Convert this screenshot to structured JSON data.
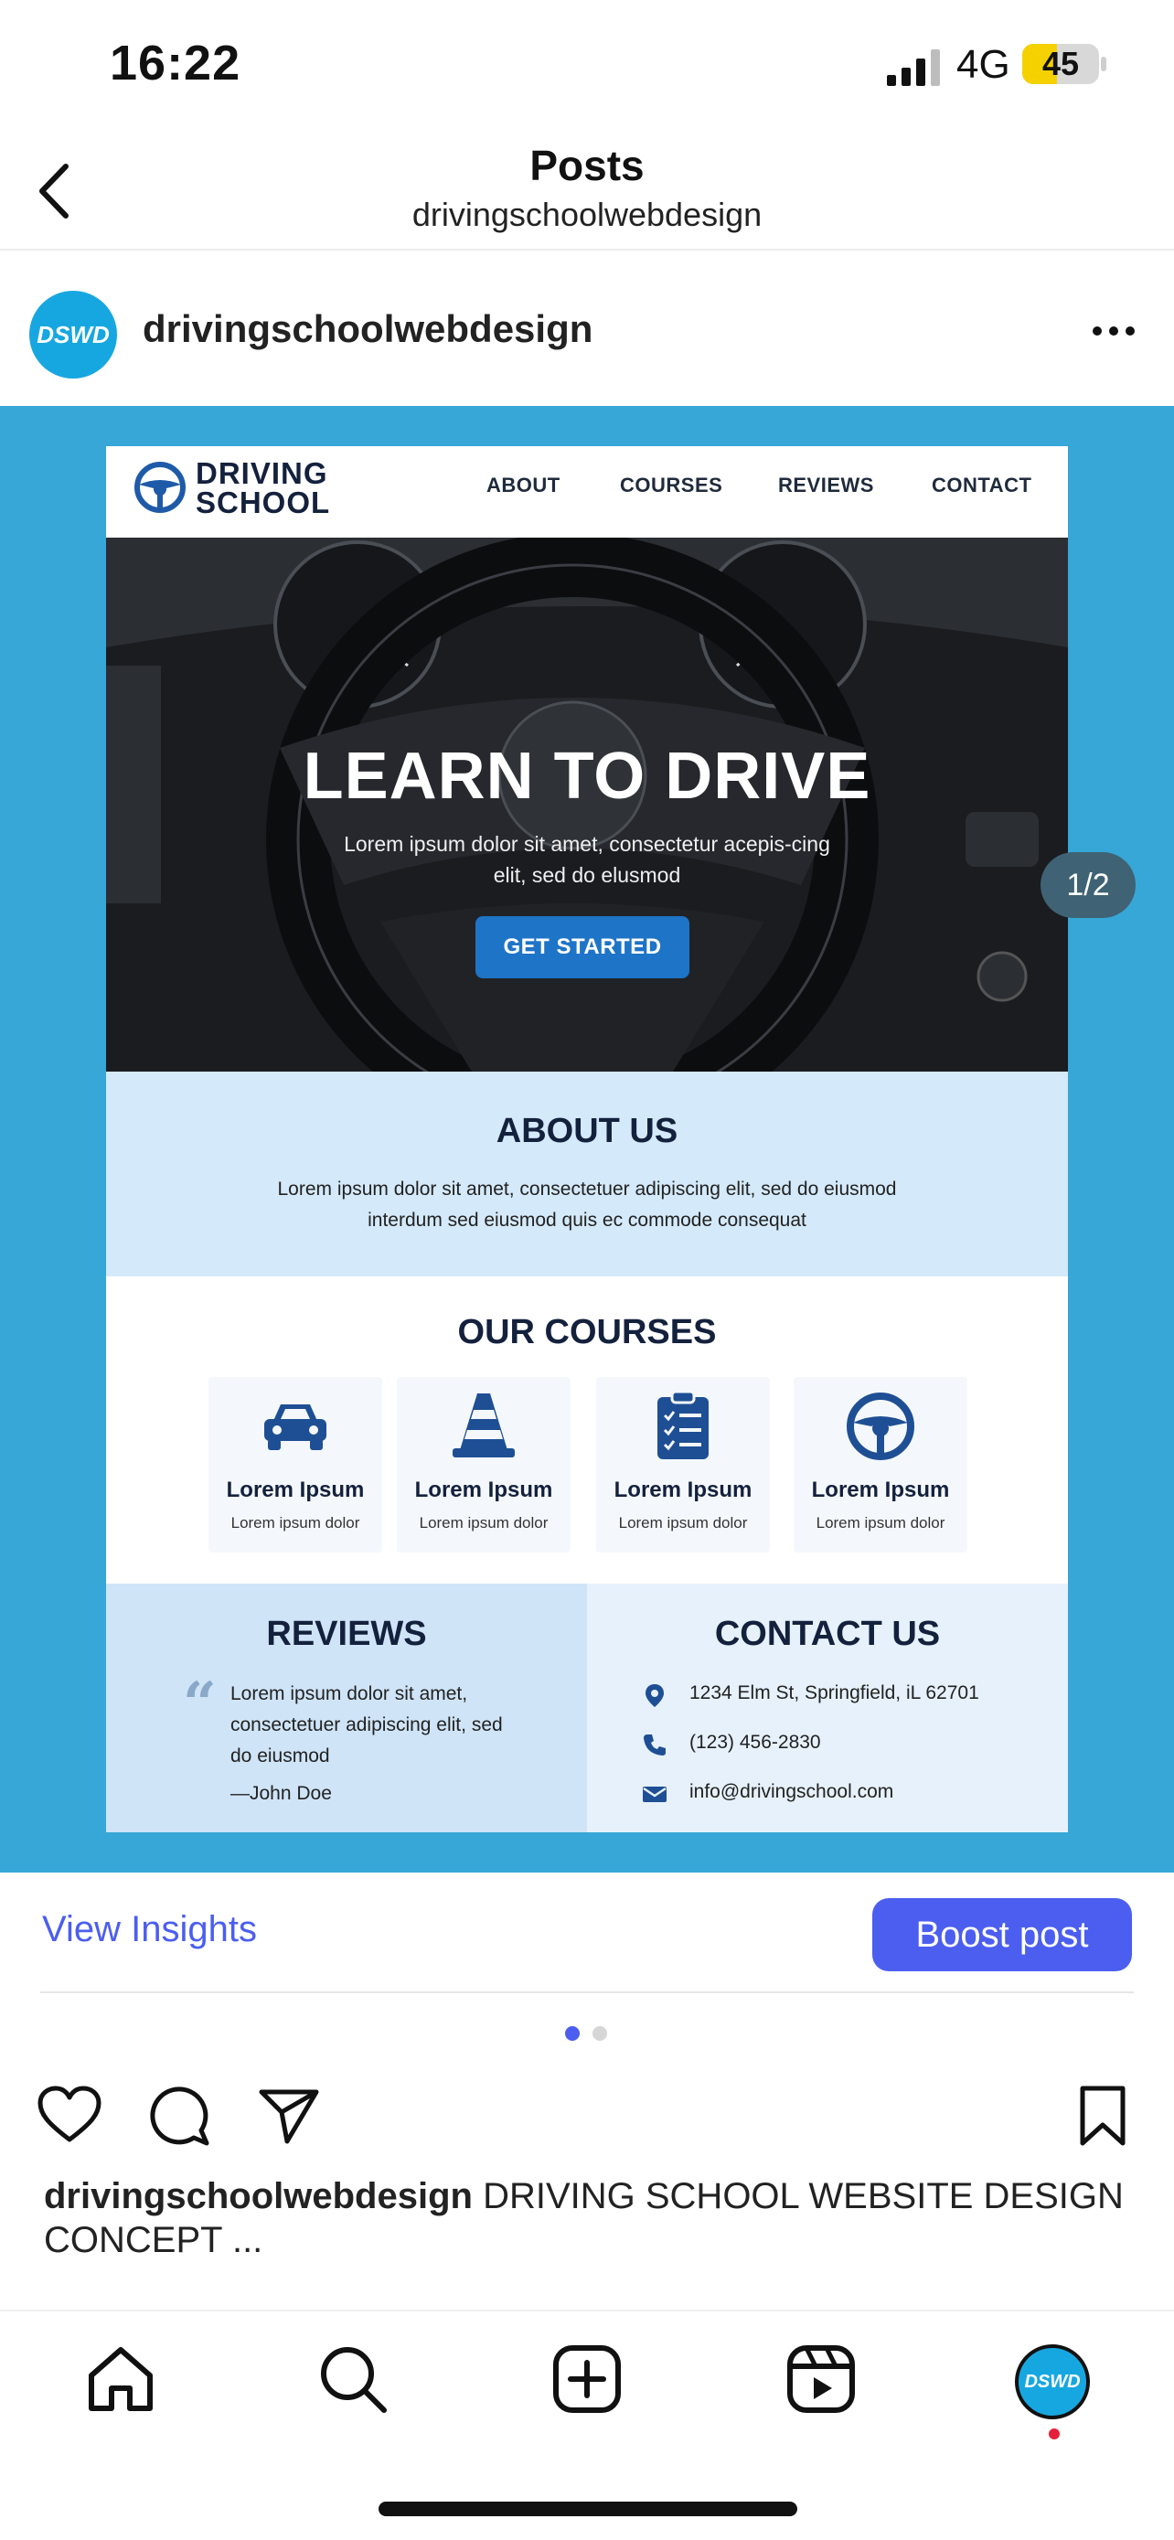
{
  "status_bar": {
    "time": "16:22",
    "network": "4G",
    "battery": "45",
    "battery_level": 0.45
  },
  "header": {
    "title": "Posts",
    "subtitle": "drivingschoolwebdesign"
  },
  "post": {
    "author": "drivingschoolwebdesign",
    "avatar_text": "DSWD",
    "page_counter": "1/2",
    "background_color": "#36a7d6"
  },
  "site": {
    "logo_line1": "DRIVING",
    "logo_line2": "SCHOOL",
    "nav": [
      "ABOUT",
      "COURSES",
      "REVIEWS",
      "CONTACT"
    ],
    "hero": {
      "title": "LEARN TO DRIVE",
      "subtitle": "Lorem ipsum dolor sit amet, consectetur acepis-cing elit, sed do elusmod",
      "button": "GET STARTED"
    },
    "about": {
      "title": "ABOUT US",
      "text": "Lorem ipsum dolor sit amet, consectetuer  adipiscing elit, sed do eiusmod interdum sed eiusmod quis ec commode consequat"
    },
    "courses": {
      "title": "OUR COURSES",
      "items": [
        {
          "icon": "car-icon",
          "title": "Lorem Ipsum",
          "sub": "Lorem ipsum dolor"
        },
        {
          "icon": "traffic-cone-icon",
          "title": "Lorem Ipsum",
          "sub": "Lorem ipsum dolor"
        },
        {
          "icon": "clipboard-checklist-icon",
          "title": "Lorem Ipsum",
          "sub": "Lorem ipsum dolor"
        },
        {
          "icon": "steering-wheel-icon",
          "title": "Lorem Ipsum",
          "sub": "Lorem ipsum dolor"
        }
      ]
    },
    "reviews": {
      "title": "REVIEWS",
      "quote": "Lorem ipsum dolor sit amet, consectetuer adipiscing elit, sed do eiusmod",
      "author": "—John Doe"
    },
    "contact": {
      "title": "CONTACT US",
      "address": "1234 Elm St, Springfield, iL 62701",
      "phone": "(123) 456-2830",
      "email": "info@drivingschool.com"
    }
  },
  "insights": {
    "view_label": "View Insights",
    "boost_label": "Boost post",
    "accent": "#4b5ef0"
  },
  "carousel": {
    "count": 2,
    "active": 1
  },
  "caption": {
    "username": "drivingschoolwebdesign",
    "text": " DRIVING SCHOOL WEBSITE DESIGN CONCEPT ..."
  },
  "tabbar": {
    "items": [
      "home-icon",
      "search-icon",
      "create-icon",
      "reels-icon",
      "profile-avatar"
    ],
    "avatar_text": "DSWD"
  }
}
